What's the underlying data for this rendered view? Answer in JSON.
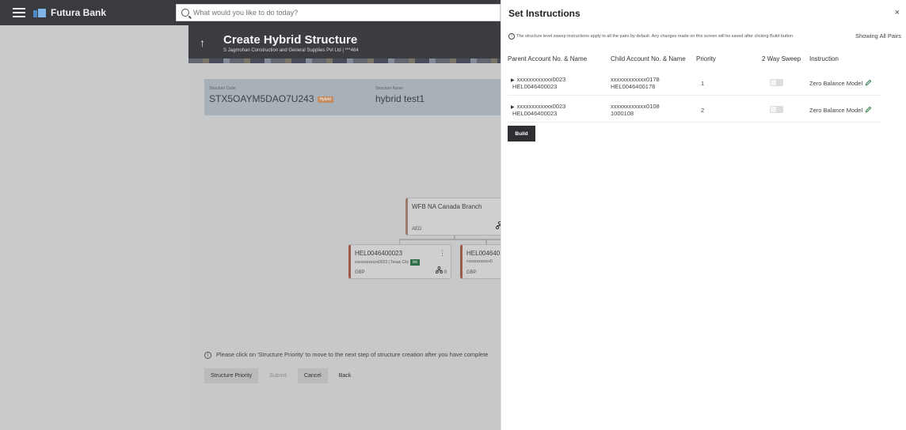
{
  "app": {
    "brand": "Futura Bank",
    "search_placeholder": "What would you like to do today?"
  },
  "page": {
    "title": "Create Hybrid Structure",
    "subtitle": "S Jagmohan Construction and General Supplies Pvt Ltd | ***464"
  },
  "structure": {
    "code_label": "Structure Code",
    "code": "STX5OAYM5DAO7U243",
    "type_badge": "Hybrid",
    "name_label": "Structure Name",
    "name": "hybrid test1"
  },
  "tree": {
    "root": {
      "title": "WFB NA Canada Branch",
      "currency": "AED"
    },
    "child1": {
      "title": "HEL0046400023",
      "sub": "xxxxxxxxxxxx0023 | Texas City",
      "badge": "Int",
      "currency": "GBP",
      "count": "0"
    },
    "child2": {
      "title": "HEL004640",
      "sub": "xxxxxxxxxxxx0",
      "currency": "GBP"
    }
  },
  "hint": "Please click on 'Structure Priority' to move to the next step of structure creation after you have complete",
  "actions": {
    "structure_priority": "Structure Priority",
    "submit": "Submit",
    "cancel": "Cancel",
    "back": "Back"
  },
  "panel": {
    "title": "Set Instructions",
    "note": "The structure level sweep instructions apply to all the pairs by default. Any changes made on this screen will be saved after clicking Build button.",
    "showing": "Showing All Pairs",
    "columns": [
      "Parent Account No. & Name",
      "Child Account No. & Name",
      "Priority",
      "2 Way Sweep",
      "Instruction"
    ],
    "rows": [
      {
        "parent_no": "xxxxxxxxxxxx0023",
        "parent_name": "HEL0046400023",
        "child_no": "xxxxxxxxxxxx0178",
        "child_name": "HEL0046400178",
        "priority": "1",
        "instruction": "Zero Balance Model"
      },
      {
        "parent_no": "xxxxxxxxxxxx0023",
        "parent_name": "HEL0046400023",
        "child_no": "xxxxxxxxxxxx0108",
        "child_name": "1000108",
        "priority": "2",
        "instruction": "Zero Balance Model"
      }
    ],
    "build": "Build"
  },
  "colors": {
    "topbar": "#3a3b3e",
    "accent_green": "#2e7d4f",
    "build_button": "#2d2f33"
  }
}
